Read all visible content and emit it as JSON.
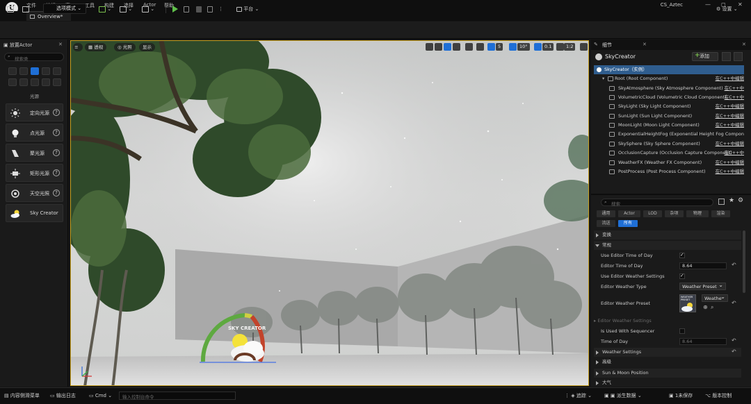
{
  "menubar": {
    "logo": "U",
    "items": [
      "文件",
      "编辑",
      "窗口",
      "工具",
      "构建",
      "选择",
      "Actor",
      "帮助"
    ],
    "project": "CS_Aztec",
    "window_buttons": [
      "—",
      "◻",
      "✕"
    ]
  },
  "tabs": {
    "active": "Overview*"
  },
  "toolbar": {
    "mode": "选项模式",
    "platform": "平台",
    "settings": "设置"
  },
  "left_panel": {
    "title": "放置Actor",
    "search_placeholder": "搜索类",
    "category_label": "光源",
    "actors": [
      {
        "label": "定向光源",
        "icon": "directional-light-icon"
      },
      {
        "label": "点光源",
        "icon": "point-light-icon"
      },
      {
        "label": "聚光源",
        "icon": "spot-light-icon"
      },
      {
        "label": "矩形光源",
        "icon": "rect-light-icon"
      },
      {
        "label": "天空光照",
        "icon": "sky-light-icon"
      },
      {
        "label": "Sky Creator",
        "icon": "cloud-sun-icon"
      }
    ],
    "help": "?"
  },
  "viewport": {
    "perspective": "透视",
    "lit": "光照",
    "show": "显示",
    "grid_value": "5",
    "angle_value": "10°",
    "scale_value": "0.1",
    "camera_value": "1:2",
    "logo_text": "SKY CREATOR"
  },
  "details": {
    "tab": "细节",
    "actor_name": "SkyCreator",
    "add_label": "添加",
    "instance_label": "SkyCreator（实例）",
    "components": [
      {
        "name": "Root (Root Component)",
        "link": "在C++中编辑"
      },
      {
        "name": "SkyAtmosphere (Sky Atmosphere Component)",
        "link": "在C++中"
      },
      {
        "name": "VolumetricCloud (Volumetric Cloud Component)",
        "link": "在C++中"
      },
      {
        "name": "SkyLight (Sky Light Component)",
        "link": "在C++中编辑"
      },
      {
        "name": "SunLight (Sun Light Component)",
        "link": "在C++中编辑"
      },
      {
        "name": "MoonLight (Moon Light Component)",
        "link": "在C++中编辑"
      },
      {
        "name": "ExponentialHeightFog (Exponential Height Fog Component)",
        "link": ""
      },
      {
        "name": "SkySphere (Sky Sphere Component)",
        "link": "在C++中编辑"
      },
      {
        "name": "OcclusionCapture (Occlusion Capture Component)",
        "link": "在C++中"
      },
      {
        "name": "WeatherFX (Weather FX Component)",
        "link": "在C++中编辑"
      },
      {
        "name": "PostProcess (Post Process Component)",
        "link": "在C++中编辑"
      }
    ],
    "search_placeholder": "搜索",
    "filters_row1": [
      "通用",
      "Actor",
      "LOD",
      "杂项",
      "物理",
      "渲染"
    ],
    "filters_row2": [
      "流送",
      "所有"
    ],
    "sections": {
      "transform": "变换",
      "default": "常规",
      "weather_settings": "Weather Settings",
      "advanced": "高级",
      "sun_moon": "Sun & Moon Position",
      "atmosphere": "大气"
    },
    "props": {
      "use_time_of_day": "Use Editor Time of Day",
      "time_of_day": "Editor Time of Day",
      "time_of_day_value": "8.64",
      "use_weather": "Use Editor Weather Settings",
      "weather_type": "Editor Weather Type",
      "weather_type_value": "Weather Preset",
      "weather_preset": "Editor Weather Preset",
      "weather_preset_thumb": "WEATHER PRESET",
      "weather_preset_value": "Weathe",
      "weather_settings_dim": "Editor Weather Settings",
      "used_with_sequencer": "Is Used With Sequencer",
      "time_of_day2": "Time of Day",
      "time_of_day2_value": "8.64"
    }
  },
  "statusbar": {
    "content_drawer": "内容侧滑菜单",
    "output_log": "输出日志",
    "cmd": "Cmd",
    "cmd_placeholder": "输入控制台命令",
    "trace": "追踪",
    "derived_data": "派生数据",
    "unsaved": "1未保存",
    "revision_control": "版本控制"
  },
  "colors": {
    "accent": "#1f6fd6",
    "selection": "#2f5d8e",
    "play": "#5fbf4a",
    "viewport_border": "#c8a020"
  }
}
